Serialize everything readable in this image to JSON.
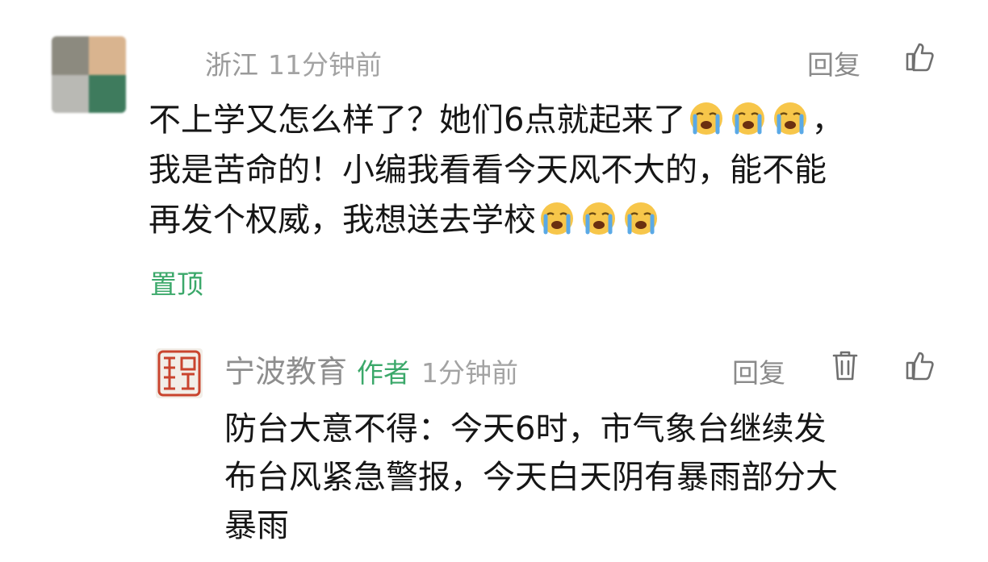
{
  "comment": {
    "username": "浙江",
    "time": "11分钟前",
    "reply_label": "回复",
    "text_line1": "不上学又怎么样了？她们6点就起来了",
    "text_line1_end": "，",
    "text_line2": "我是苦命的！小编我看看今天风不大的，能不能",
    "text_line3": "再发个权威，我想送去学校",
    "emoji": "loudly-crying-face",
    "pinned_label": "置顶"
  },
  "reply": {
    "author_name": "宁波教育",
    "author_badge": "作者",
    "time": "1分钟前",
    "reply_label": "回复",
    "text_line1": "防台大意不得：今天6时，市气象台继续发",
    "text_line2": "布台风紧急警报，今天白天阴有暴雨部分大",
    "text_line3": "暴雨"
  },
  "colors": {
    "accent_green": "#3ba86a",
    "muted_text": "#9a9a9a",
    "seal_red": "#c9442e"
  },
  "icons": {
    "like": "thumbs-up-icon",
    "delete": "trash-icon",
    "emoji": "crying-face-emoji"
  }
}
